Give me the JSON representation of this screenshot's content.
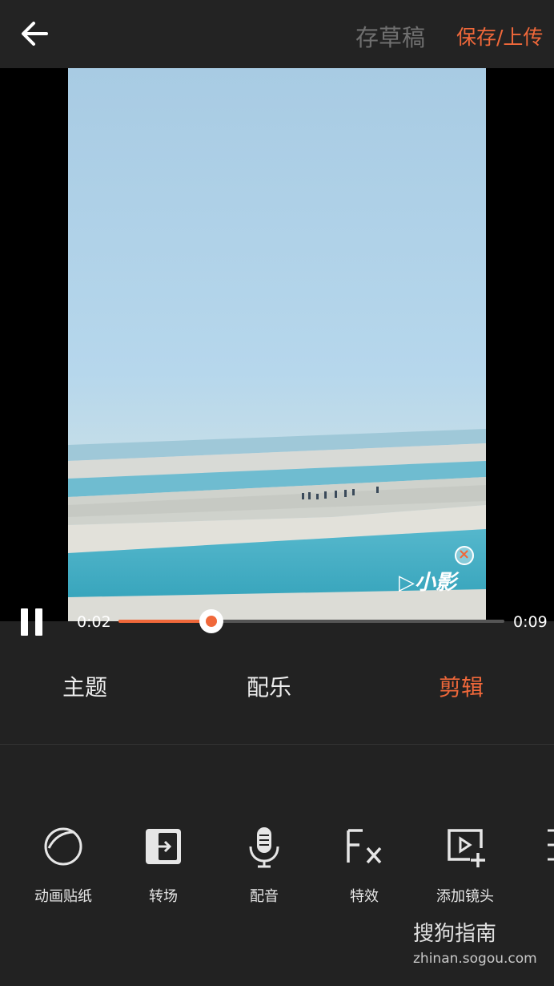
{
  "topbar": {
    "back_icon": "arrow-left-icon",
    "draft_label": "存草稿",
    "save_label": "保存/上传",
    "accent": "#f0683a"
  },
  "player": {
    "watermark_close_icon": "close-icon",
    "watermark_logo": "▷小影",
    "pause_icon": "pause-icon",
    "current_time": "0:02",
    "total_time": "0:09",
    "progress": 0.24
  },
  "tabs": [
    {
      "label": "主题",
      "active": false
    },
    {
      "label": "配乐",
      "active": false
    },
    {
      "label": "剪辑",
      "active": true
    }
  ],
  "tools": [
    {
      "label": "动画贴纸",
      "icon": "sticker-icon"
    },
    {
      "label": "转场",
      "icon": "transition-icon"
    },
    {
      "label": "配音",
      "icon": "microphone-icon"
    },
    {
      "label": "特效",
      "icon": "fx-icon"
    },
    {
      "label": "添加镜头",
      "icon": "add-clip-icon"
    }
  ],
  "watermark": {
    "brand": "搜狗指南",
    "url": "zhinan.sogou.com"
  }
}
